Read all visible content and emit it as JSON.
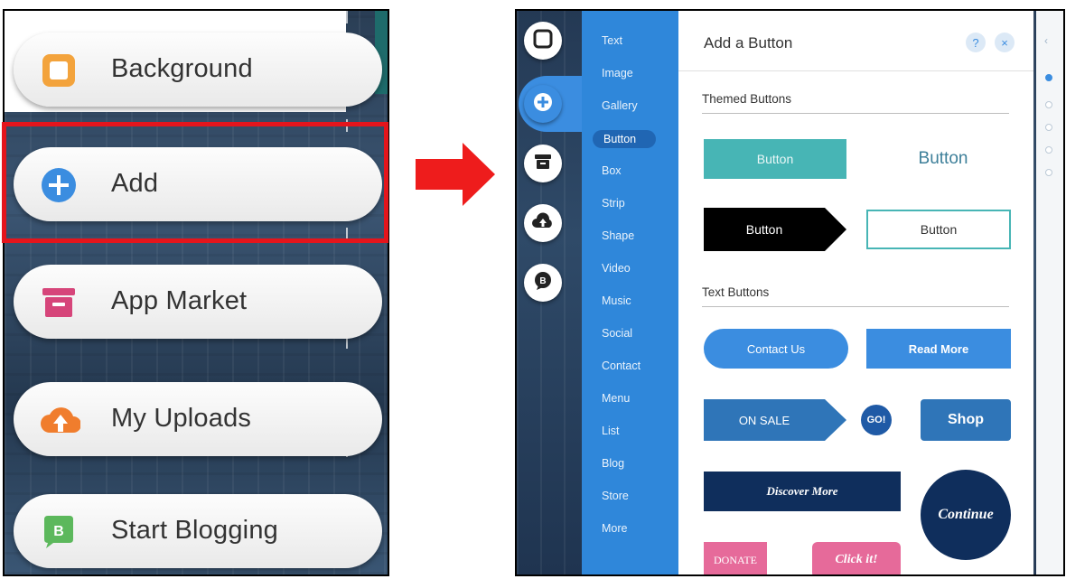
{
  "left_menu": {
    "items": [
      {
        "label": "Background",
        "icon": "square-outline-icon"
      },
      {
        "label": "Add",
        "icon": "plus-circle-icon"
      },
      {
        "label": "App Market",
        "icon": "store-icon"
      },
      {
        "label": "My Uploads",
        "icon": "cloud-upload-icon"
      },
      {
        "label": "Start Blogging",
        "icon": "blog-chat-icon"
      }
    ],
    "highlighted_item": "Add",
    "highlight_color": "#e4151c"
  },
  "arrow": {
    "color": "#ee1c1c"
  },
  "panel": {
    "categories": [
      "Text",
      "Image",
      "Gallery",
      "Button",
      "Box",
      "Strip",
      "Shape",
      "Video",
      "Music",
      "Social",
      "Contact",
      "Menu",
      "List",
      "Blog",
      "Store",
      "More"
    ],
    "active_category": "Button",
    "title": "Add a Button",
    "help_label": "?",
    "close_label": "×",
    "themed_section": "Themed Buttons",
    "text_section": "Text Buttons",
    "themed_buttons": [
      {
        "label": "Button",
        "style": "teal-filled"
      },
      {
        "label": "Button",
        "style": "teal-text"
      },
      {
        "label": "Button",
        "style": "black-arrow"
      },
      {
        "label": "Button",
        "style": "teal-outline"
      }
    ],
    "text_buttons": [
      {
        "label": "Contact Us",
        "style": "blue-pill"
      },
      {
        "label": "Read More",
        "style": "blue-rect"
      },
      {
        "label": "ON SALE",
        "style": "blue-arrow"
      },
      {
        "label": "GO!",
        "style": "navy-circle-small"
      },
      {
        "label": "Shop",
        "style": "blue-rounded"
      },
      {
        "label": "Discover More",
        "style": "navy-rect"
      },
      {
        "label": "Continue",
        "style": "navy-circle-large"
      },
      {
        "label": "DONATE",
        "style": "pink"
      },
      {
        "label": "Click it!",
        "style": "pink-rounded"
      }
    ],
    "colors": {
      "accent": "#3b8de0",
      "teal": "#47b5b5",
      "navy": "#0f2e5c",
      "pink": "#e66a9a"
    }
  }
}
